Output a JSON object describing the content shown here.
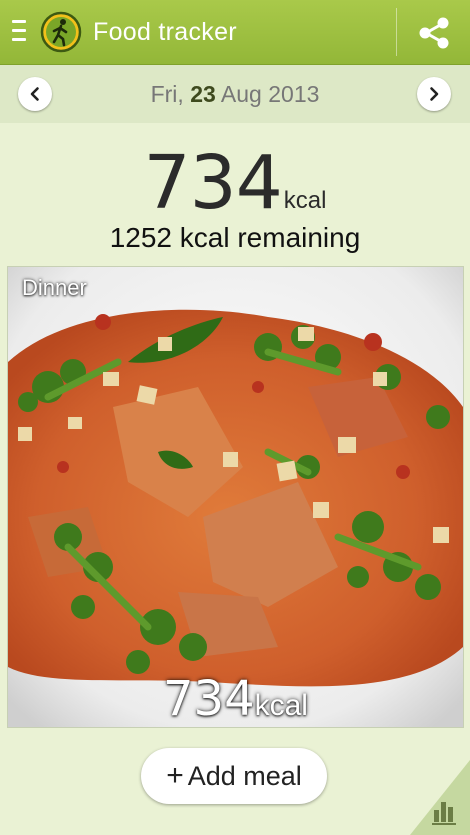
{
  "app": {
    "title": "Food tracker"
  },
  "date": {
    "weekday": "Fri,",
    "day": "23",
    "month_year": "Aug 2013"
  },
  "totals": {
    "consumed": "734",
    "unit": "kcal",
    "remaining_text": "1252 kcal remaining"
  },
  "meal": {
    "label": "Dinner",
    "kcal": "734",
    "unit": "kcal"
  },
  "actions": {
    "add_meal": "Add meal",
    "add_symbol": "+"
  },
  "icons": {
    "menu": "menu-icon",
    "logo": "walking-figure-logo",
    "share": "share-icon",
    "prev": "chevron-left-icon",
    "next": "chevron-right-icon",
    "stats": "bar-chart-icon"
  },
  "colors": {
    "accent": "#9dc03f",
    "background": "#eaf2d4",
    "date_bar": "#dde8c6"
  }
}
